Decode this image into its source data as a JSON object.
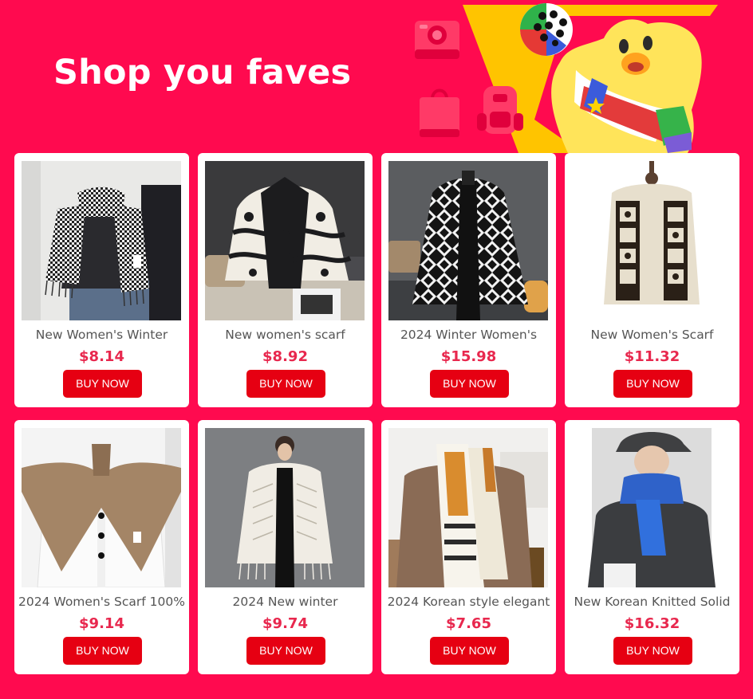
{
  "banner": {
    "title": "Shop you faves",
    "colors": {
      "background": "#ff0a4f",
      "accent_yellow": "#ffc400",
      "button_red": "#e60012",
      "price": "#e8284e"
    },
    "decorations": [
      "camera-icon",
      "shopping-bag-icon",
      "backpack-icon",
      "mascot-character",
      "soccer-ball"
    ]
  },
  "products": [
    {
      "name": "New Women's Winter",
      "price": "$8.14",
      "button": "BUY NOW",
      "image": "houndstooth-scarf"
    },
    {
      "name": "New women's scarf",
      "price": "$8.92",
      "button": "BUY NOW",
      "image": "paisley-shawl"
    },
    {
      "name": "2024 Winter Women's",
      "price": "$15.98",
      "button": "BUY NOW",
      "image": "diamond-pattern-shawl"
    },
    {
      "name": "New Women's Scarf",
      "price": "$11.32",
      "button": "BUY NOW",
      "image": "horse-print-scarf"
    },
    {
      "name": "2024 Women's Scarf 100%",
      "price": "$9.14",
      "button": "BUY NOW",
      "image": "knit-collar-scarf"
    },
    {
      "name": "2024 New winter",
      "price": "$9.74",
      "button": "BUY NOW",
      "image": "knit-poncho"
    },
    {
      "name": "2024 Korean style elegant",
      "price": "$7.65",
      "button": "BUY NOW",
      "image": "striped-scarf"
    },
    {
      "name": "New Korean Knitted Solid",
      "price": "$16.32",
      "button": "BUY NOW",
      "image": "blue-knit-scarf"
    }
  ]
}
